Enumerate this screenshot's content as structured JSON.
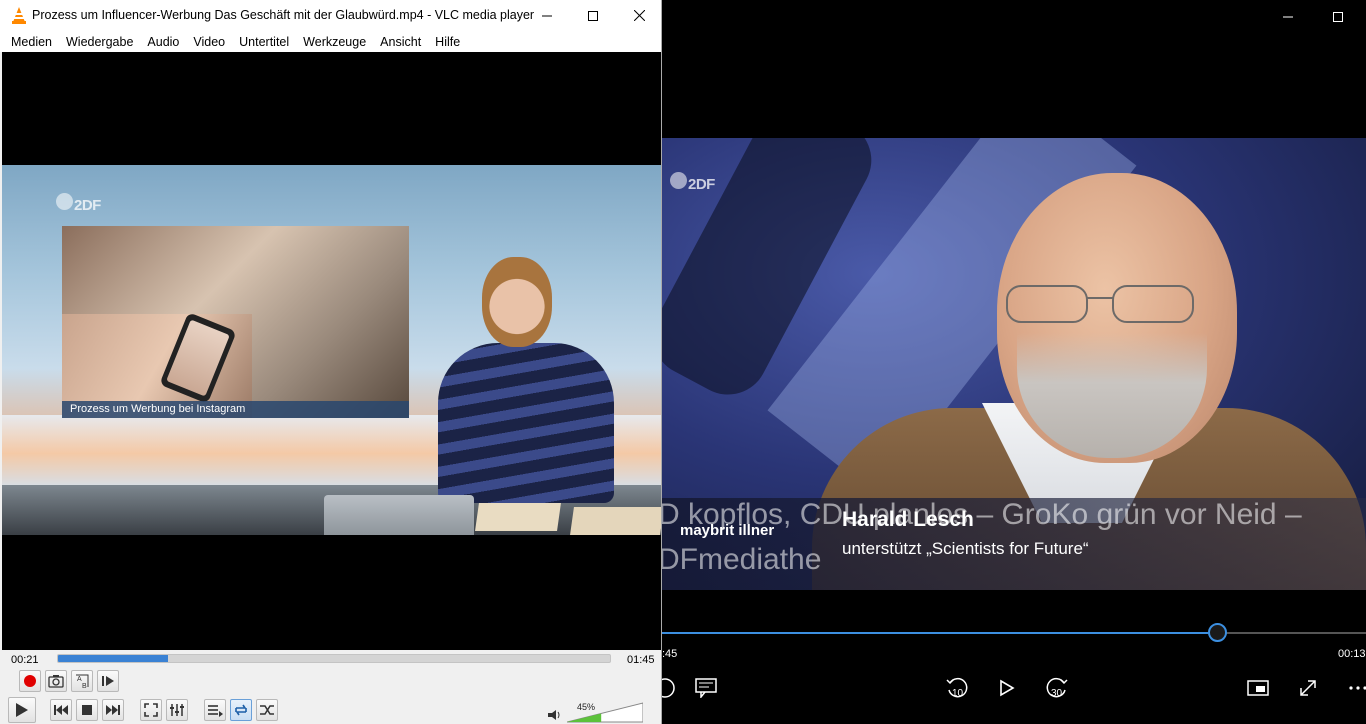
{
  "vlc": {
    "title": "Prozess um Influencer-Werbung Das Geschäft mit der Glaubwürd.mp4 - VLC media player",
    "menu": [
      "Medien",
      "Wiedergabe",
      "Audio",
      "Video",
      "Untertitel",
      "Werkzeuge",
      "Ansicht",
      "Hilfe"
    ],
    "video": {
      "channel_logo": "2DF",
      "inset_caption": "Prozess um Werbung bei Instagram"
    },
    "controls": {
      "elapsed": "00:21",
      "duration": "01:45",
      "progress_fraction": 0.2,
      "volume_label": "45%",
      "volume_fraction": 0.45,
      "buttons": [
        "record",
        "snapshot",
        "loop-ab",
        "frame-step",
        "play",
        "previous",
        "stop",
        "next",
        "fullscreen",
        "extended-settings",
        "playlist",
        "loop",
        "random"
      ]
    },
    "colors": {
      "accent": "#3a82d4",
      "record": "#e00000"
    }
  },
  "player2": {
    "video": {
      "channel_logo": "2DF",
      "show_name": "maybrit illner",
      "person_name": "Harald Lesch",
      "subtitle": "unterstützt „Scientists for Future“",
      "overlay_line1": "D kopflos, CDU planlos – GroKo grün vor Neid –",
      "overlay_line2": "DFmediathe"
    },
    "controls": {
      "elapsed": ":45",
      "remaining": "00:13",
      "progress_fraction": 0.79,
      "skip_back_label": "10",
      "skip_forward_label": "30"
    },
    "colors": {
      "accent": "#3c8fe0"
    }
  }
}
